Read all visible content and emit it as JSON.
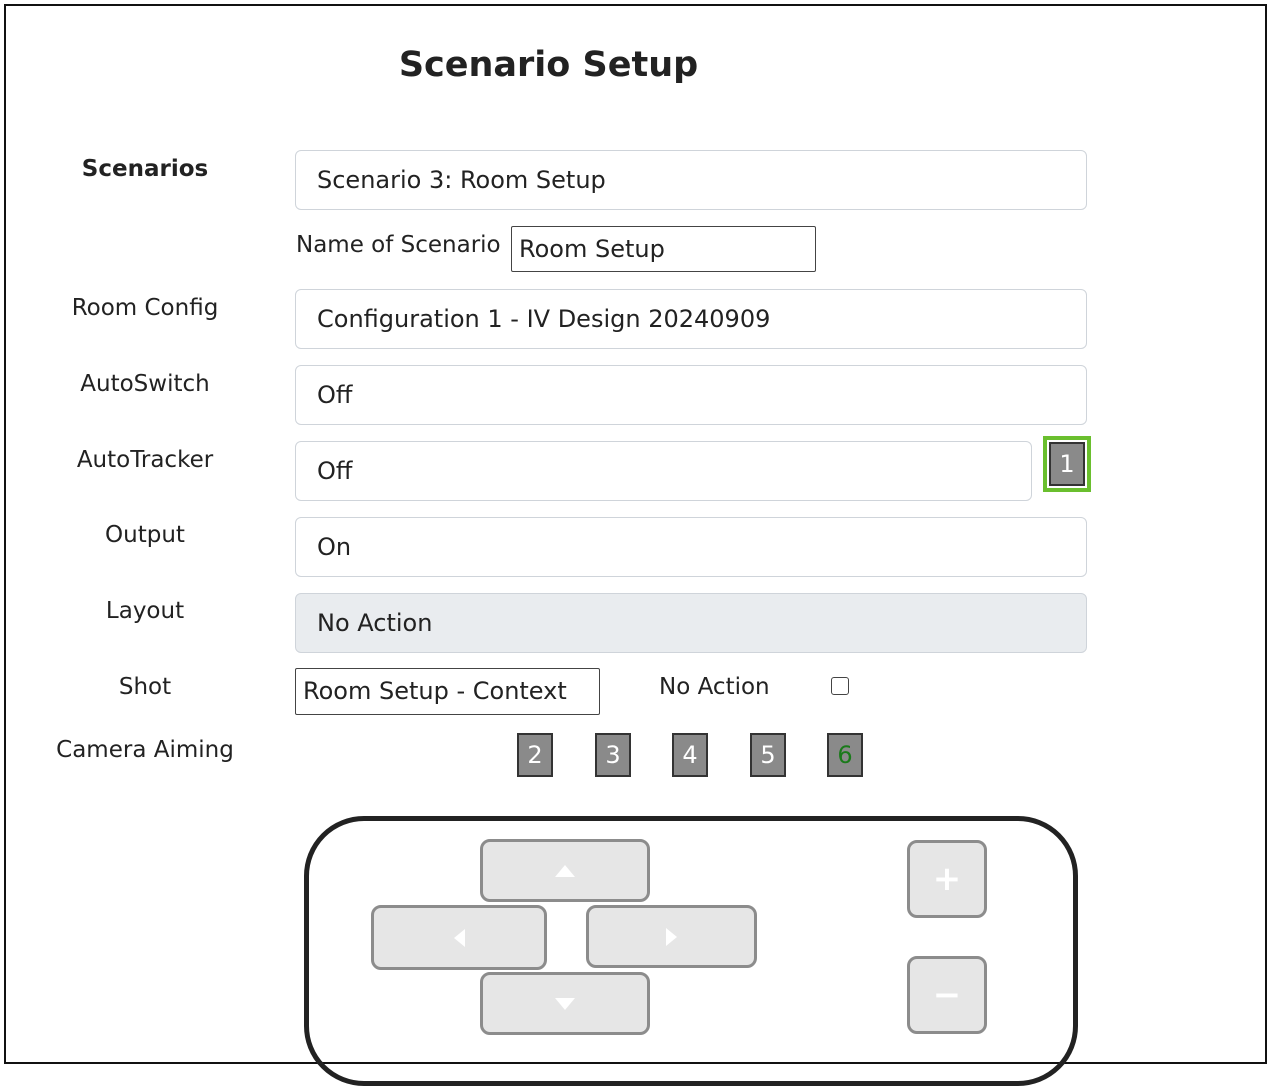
{
  "page": {
    "title": "Scenario Setup"
  },
  "form": {
    "scenarios": {
      "label": "Scenarios",
      "value": "Scenario 3: Room Setup"
    },
    "name_of_scenario": {
      "label": "Name of Scenario",
      "value": "Room Setup"
    },
    "room_config": {
      "label": "Room Config",
      "value": "Configuration 1 - IV Design 20240909"
    },
    "autoswitch": {
      "label": "AutoSwitch",
      "value": "Off"
    },
    "autotracker": {
      "label": "AutoTracker",
      "value": "Off",
      "button": "1"
    },
    "output": {
      "label": "Output",
      "value": "On"
    },
    "layout": {
      "label": "Layout",
      "value": "No Action"
    },
    "shot": {
      "label": "Shot",
      "value": "Room Setup - Context",
      "no_action_label": "No Action",
      "no_action_checked": false
    },
    "camera_aiming": {
      "label": "Camera Aiming",
      "buttons": [
        "2",
        "3",
        "4",
        "5",
        "6"
      ],
      "active_button": "6"
    }
  },
  "ptz": {
    "up_icon": "triangle-up",
    "left_icon": "triangle-left",
    "right_icon": "triangle-right",
    "down_icon": "triangle-down",
    "zoom_in": "+",
    "zoom_out": "−"
  },
  "colors": {
    "highlight": "#6abf2e",
    "active_text": "#1a7a1a",
    "button_gray": "#8a8a8a"
  }
}
